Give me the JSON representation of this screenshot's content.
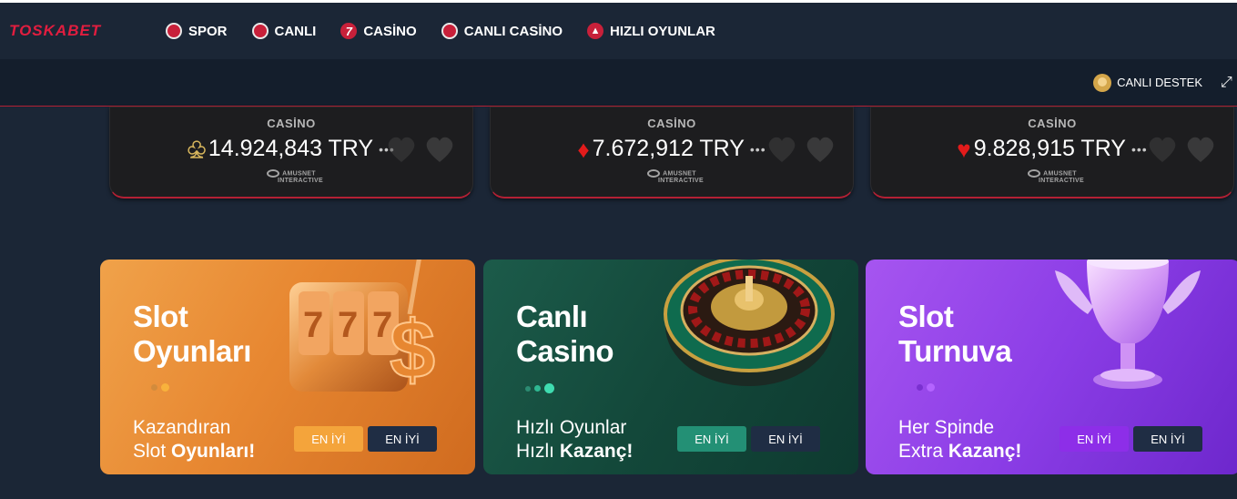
{
  "header": {
    "logo": "TOSKABET",
    "nav": [
      {
        "label": "SPOR",
        "icon": "soccer-ball-icon"
      },
      {
        "label": "CANLI",
        "icon": "live-ball-icon"
      },
      {
        "label": "CASİNO",
        "icon": "seven-icon"
      },
      {
        "label": "CANLI CASİNO",
        "icon": "roulette-chip-icon"
      },
      {
        "label": "HIZLI OYUNLAR",
        "icon": "rocket-icon"
      }
    ]
  },
  "subbar": {
    "support_label": "CANLI DESTEK"
  },
  "jackpots": [
    {
      "title": "CASİNO",
      "amount": "14.924,843 TRY",
      "suit": "club",
      "provider": "AMUSNET",
      "provider_sub": "INTERACTIVE"
    },
    {
      "title": "CASİNO",
      "amount": "7.672,912 TRY",
      "suit": "diamond",
      "provider": "AMUSNET",
      "provider_sub": "INTERACTIVE"
    },
    {
      "title": "CASİNO",
      "amount": "9.828,915 TRY",
      "suit": "heart",
      "provider": "AMUSNET",
      "provider_sub": "INTERACTIVE"
    }
  ],
  "promos": [
    {
      "title_1": "Slot",
      "title_2": "Oyunları",
      "desc_1": "Kazandıran",
      "desc_2a": "Slot ",
      "desc_2b": "Oyunları!",
      "btn_primary": "EN İYİ",
      "btn_secondary": "EN İYİ",
      "accent": "#f4a43b"
    },
    {
      "title_1": "Canlı",
      "title_2": "Casino",
      "desc_1": "Hızlı Oyunlar",
      "desc_2a": "Hızlı ",
      "desc_2b": "Kazanç!",
      "btn_primary": "EN İYİ",
      "btn_secondary": "EN İYİ",
      "accent": "#239075"
    },
    {
      "title_1": "Slot",
      "title_2": "Turnuva",
      "desc_1": "Her Spinde",
      "desc_2a": "Extra ",
      "desc_2b": "Kazanç!",
      "btn_primary": "EN İYİ",
      "btn_secondary": "EN İYİ",
      "accent": "#8d2ee8"
    }
  ]
}
